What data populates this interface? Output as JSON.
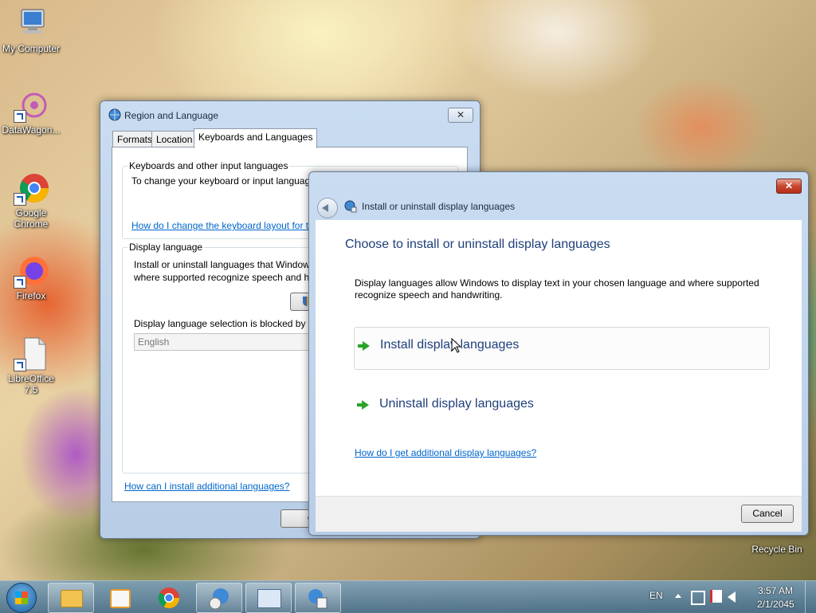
{
  "desktop": {
    "icons": [
      {
        "label": "My Computer"
      },
      {
        "label": "DataWagon..."
      },
      {
        "label": "Google Chrome"
      },
      {
        "label": "Firefox"
      },
      {
        "label": "LibreOffice 7.5"
      },
      {
        "label": "Recycle Bin"
      }
    ]
  },
  "region_window": {
    "title": "Region and Language",
    "close": "✕",
    "tabs": [
      "Formats",
      "Location",
      "Keyboards and Languages"
    ],
    "keyboards_group": {
      "title": "Keyboards and other input languages",
      "text": "To change your keyboard or input languag",
      "link": "How do I change the keyboard layout for t"
    },
    "display_group": {
      "title": "Display language",
      "text_line1": "Install or uninstall languages that Window",
      "text_line2": "where supported recognize speech and ha",
      "blocked_text": "Display language selection is blocked by g",
      "select_value": "English"
    },
    "footer_link": "How can I install additional languages?",
    "ok_button": "O"
  },
  "install_dialog": {
    "header_title": "Install or uninstall display languages",
    "close": "✕",
    "heading": "Choose to install or uninstall display languages",
    "description": "Display languages allow Windows to display text in your chosen language and where supported recognize speech and handwriting.",
    "commands": [
      {
        "label": "Install display languages"
      },
      {
        "label": "Uninstall display languages"
      }
    ],
    "help_link": "How do I get additional display languages?",
    "cancel_button": "Cancel"
  },
  "taskbar": {
    "language": "EN",
    "time": "3:57 AM",
    "date": "2/1/2045"
  },
  "colors": {
    "link": "#0066cc",
    "heading": "#1e3f7a",
    "arrow": "#29a329"
  }
}
